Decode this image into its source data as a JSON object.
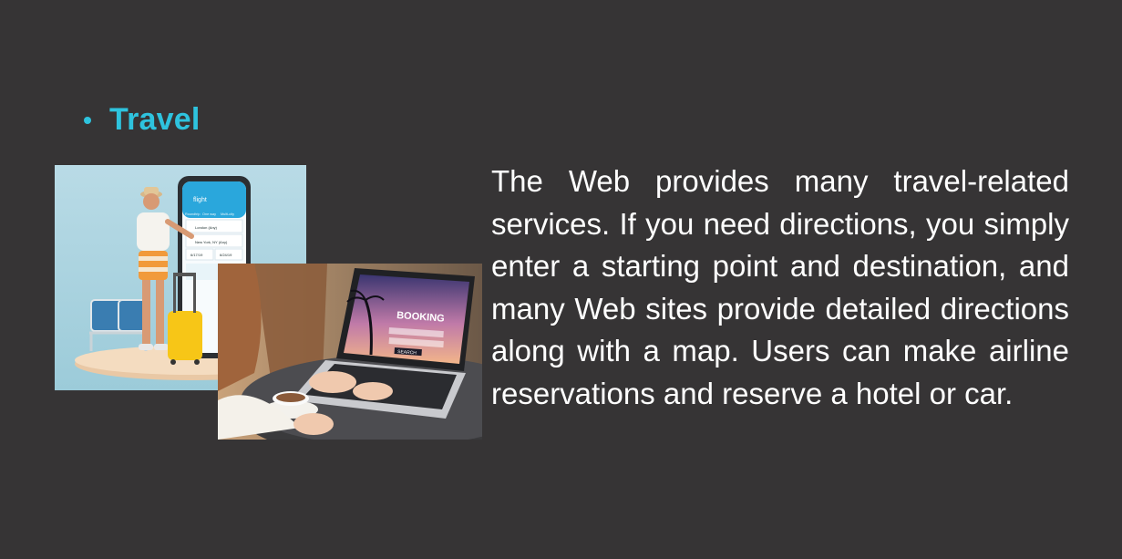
{
  "section": {
    "heading": "Travel"
  },
  "content": {
    "paragraph": "The Web provides many travel-related services. If you need directions, you simply enter a starting point and destination, and many Web sites provide detailed directions along with a map. Users can make airline reservations and reserve a hotel or car."
  },
  "images": {
    "phone_app": {
      "screen_title": "flight",
      "tabs": [
        "Roundtrip",
        "One way",
        "Multi-city"
      ],
      "from": "London (Any)",
      "to": "New York, NY (Any)",
      "depart": "6/17/19",
      "return": "6/24/19"
    },
    "laptop": {
      "screen_title": "BOOKING",
      "button": "SEARCH"
    }
  },
  "colors": {
    "background": "#363435",
    "accent": "#2ec3de",
    "text": "#ffffff"
  }
}
